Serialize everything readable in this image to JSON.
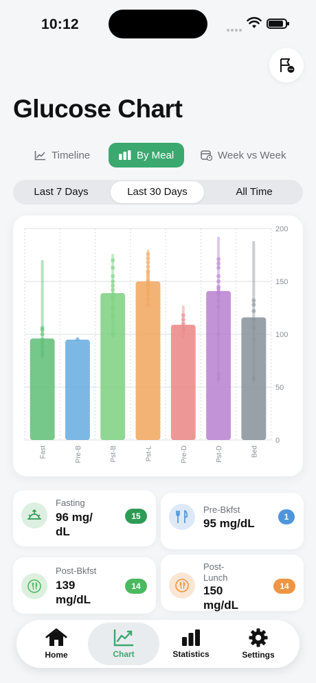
{
  "status": {
    "time": "10:12"
  },
  "header": {
    "title": "Glucose Chart"
  },
  "view_tabs": [
    {
      "label": "Timeline",
      "active": false
    },
    {
      "label": "By Meal",
      "active": true
    },
    {
      "label": "Week vs Week",
      "active": false
    }
  ],
  "ranges": [
    {
      "label": "Last 7 Days",
      "active": false
    },
    {
      "label": "Last 30 Days",
      "active": true
    },
    {
      "label": "All Time",
      "active": false
    }
  ],
  "chart_data": {
    "type": "bar",
    "categories": [
      "Fast",
      "Pre-B",
      "Pst-B",
      "Pst-L",
      "Pre-D",
      "Pst-D",
      "Bed"
    ],
    "values": [
      96,
      95,
      139,
      150,
      109,
      141,
      116
    ],
    "ranges": [
      [
        78,
        169
      ],
      [
        95,
        96
      ],
      [
        98,
        175
      ],
      [
        127,
        179
      ],
      [
        98,
        126
      ],
      [
        55,
        191
      ],
      [
        55,
        187
      ]
    ],
    "points": [
      [
        80,
        84,
        88,
        92,
        95,
        100,
        104,
        106
      ],
      [
        95
      ],
      [
        100,
        118,
        125,
        134,
        138,
        142,
        146,
        150,
        155,
        163,
        170
      ],
      [
        128,
        133,
        138,
        142,
        146,
        150,
        152,
        155,
        158,
        160,
        164,
        168,
        172,
        176
      ],
      [
        104,
        110,
        114,
        118
      ],
      [
        58,
        62,
        100,
        126,
        132,
        138,
        140,
        143,
        145,
        150,
        155,
        163,
        167,
        171
      ],
      [
        58,
        95,
        106,
        114,
        122,
        128,
        132
      ]
    ],
    "colors": [
      "#63bf7a",
      "#6aaedf",
      "#7fd184",
      "#f0a862",
      "#ec8989",
      "#bb84d1",
      "#8a949c"
    ],
    "yticks": [
      0,
      50,
      100,
      150,
      200
    ],
    "ylim": [
      0,
      200
    ],
    "grid": true
  },
  "meals": [
    {
      "name": "Fasting",
      "value": "96 mg/\ndL",
      "count": "15",
      "color": "#2f9a55",
      "icon": "sunrise-icon"
    },
    {
      "name": "Pre-Bkfst",
      "value": "95 mg/dL",
      "count": "1",
      "color": "#4f95d9",
      "icon": "fork-knife-icon"
    },
    {
      "name": "Post-Bkfst",
      "value": "139\nmg/dL",
      "count": "14",
      "color": "#4cb860",
      "icon": "plate-icon"
    },
    {
      "name": "Post-\nLunch",
      "value": "150\nmg/dL",
      "count": "14",
      "color": "#ee9544",
      "icon": "plate-icon"
    }
  ],
  "tabbar": [
    {
      "label": "Home",
      "icon": "house-icon",
      "active": false
    },
    {
      "label": "Chart",
      "icon": "chart-line-icon",
      "active": true
    },
    {
      "label": "Statistics",
      "icon": "bar-chart-icon",
      "active": false
    },
    {
      "label": "Settings",
      "icon": "gear-icon",
      "active": false
    }
  ]
}
